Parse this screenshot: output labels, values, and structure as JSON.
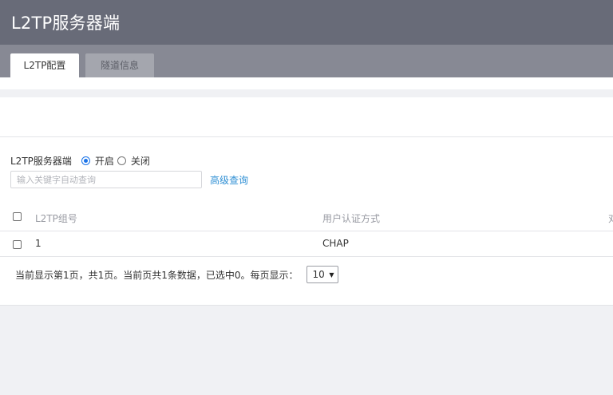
{
  "header": {
    "title": "L2TP服务器端"
  },
  "tabs": [
    {
      "label": "L2TP配置",
      "active": true
    },
    {
      "label": "隧道信息",
      "active": false
    }
  ],
  "server": {
    "label": "L2TP服务器端",
    "options": [
      "开启",
      "关闭"
    ],
    "selected": "开启"
  },
  "search": {
    "placeholder": "输入关键字自动查询",
    "value": "",
    "advanced_label": "高级查询"
  },
  "table": {
    "columns": [
      "L2TP组号",
      "用户认证方式",
      "对"
    ],
    "rows": [
      {
        "group": "1",
        "auth": "CHAP",
        "checked": false
      }
    ]
  },
  "pager": {
    "summary": "当前显示第1页，共1页。当前页共1条数据，已选中0。每页显示：",
    "page_size": "10"
  },
  "colors": {
    "header_bg": "#686b78",
    "tabbar_bg": "#878994",
    "link": "#2f8fd4",
    "radio_accent": "#1a73e8"
  }
}
